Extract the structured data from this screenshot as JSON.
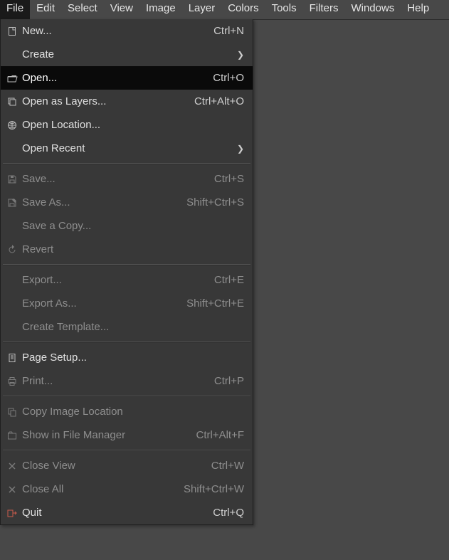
{
  "menubar": {
    "items": [
      {
        "label": "File",
        "active": true
      },
      {
        "label": "Edit"
      },
      {
        "label": "Select"
      },
      {
        "label": "View"
      },
      {
        "label": "Image"
      },
      {
        "label": "Layer"
      },
      {
        "label": "Colors"
      },
      {
        "label": "Tools"
      },
      {
        "label": "Filters"
      },
      {
        "label": "Windows"
      },
      {
        "label": "Help"
      }
    ]
  },
  "file_menu": {
    "groups": [
      [
        {
          "id": "new",
          "label": "New...",
          "accel": "Ctrl+N",
          "icon": "file-new"
        },
        {
          "id": "create",
          "label": "Create",
          "submenu": true
        },
        {
          "id": "open",
          "label": "Open...",
          "accel": "Ctrl+O",
          "icon": "folder-open",
          "highlight": true
        },
        {
          "id": "open-as-layers",
          "label": "Open as Layers...",
          "accel": "Ctrl+Alt+O",
          "icon": "layers"
        },
        {
          "id": "open-location",
          "label": "Open Location...",
          "icon": "globe"
        },
        {
          "id": "open-recent",
          "label": "Open Recent",
          "submenu": true
        }
      ],
      [
        {
          "id": "save",
          "label": "Save...",
          "accel": "Ctrl+S",
          "icon": "save",
          "disabled": true
        },
        {
          "id": "save-as",
          "label": "Save As...",
          "accel": "Shift+Ctrl+S",
          "icon": "save-as",
          "disabled": true
        },
        {
          "id": "save-a-copy",
          "label": "Save a Copy...",
          "disabled": true
        },
        {
          "id": "revert",
          "label": "Revert",
          "icon": "revert",
          "disabled": true
        }
      ],
      [
        {
          "id": "export",
          "label": "Export...",
          "accel": "Ctrl+E",
          "disabled": true
        },
        {
          "id": "export-as",
          "label": "Export As...",
          "accel": "Shift+Ctrl+E",
          "disabled": true
        },
        {
          "id": "create-template",
          "label": "Create Template...",
          "disabled": true
        }
      ],
      [
        {
          "id": "page-setup",
          "label": "Page Setup...",
          "icon": "page-setup"
        },
        {
          "id": "print",
          "label": "Print...",
          "accel": "Ctrl+P",
          "icon": "print",
          "disabled": true
        }
      ],
      [
        {
          "id": "copy-image-location",
          "label": "Copy Image Location",
          "icon": "copy",
          "disabled": true
        },
        {
          "id": "show-in-file-manager",
          "label": "Show in File Manager",
          "accel": "Ctrl+Alt+F",
          "icon": "file-manager",
          "disabled": true
        }
      ],
      [
        {
          "id": "close-view",
          "label": "Close View",
          "accel": "Ctrl+W",
          "icon": "close",
          "disabled": true
        },
        {
          "id": "close-all",
          "label": "Close All",
          "accel": "Shift+Ctrl+W",
          "icon": "close",
          "disabled": true
        },
        {
          "id": "quit",
          "label": "Quit",
          "accel": "Ctrl+Q",
          "icon": "quit"
        }
      ]
    ]
  },
  "arrow_glyph": "❯"
}
